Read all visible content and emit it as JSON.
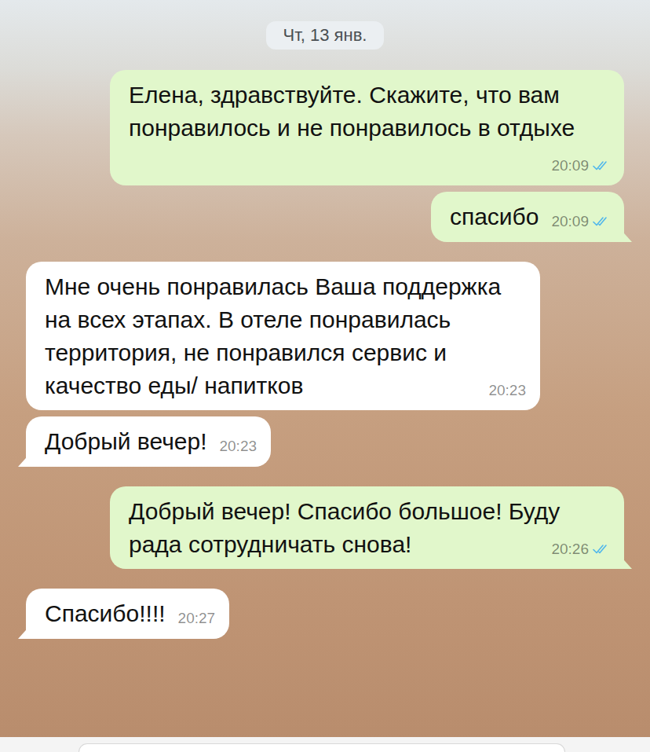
{
  "date": "Чт, 13 янв.",
  "messages": [
    {
      "kind": "outgoing",
      "text": "Елена, здравствуйте. Скажите, что вам понравилось и не понравилось в отдыхе",
      "time": "20:09",
      "read": true,
      "tail": false
    },
    {
      "kind": "outgoing",
      "text": "спасибо",
      "time": "20:09",
      "read": true,
      "tail": true
    },
    {
      "kind": "incoming",
      "text": "Мне очень понравилась Ваша поддержка на всех этапах. В отеле понравилась территория, не понравился сервис и качество еды/ напитков",
      "time": "20:23",
      "tail": false
    },
    {
      "kind": "incoming",
      "text": "Добрый вечер!",
      "time": "20:23",
      "tail": true
    },
    {
      "kind": "outgoing",
      "text": "Добрый вечер! Спасибо большое! Буду рада сотрудничать снова!",
      "time": "20:26",
      "read": true,
      "tail": true
    },
    {
      "kind": "incoming",
      "text": "Спасибо!!!!",
      "time": "20:27",
      "tail": true
    }
  ]
}
